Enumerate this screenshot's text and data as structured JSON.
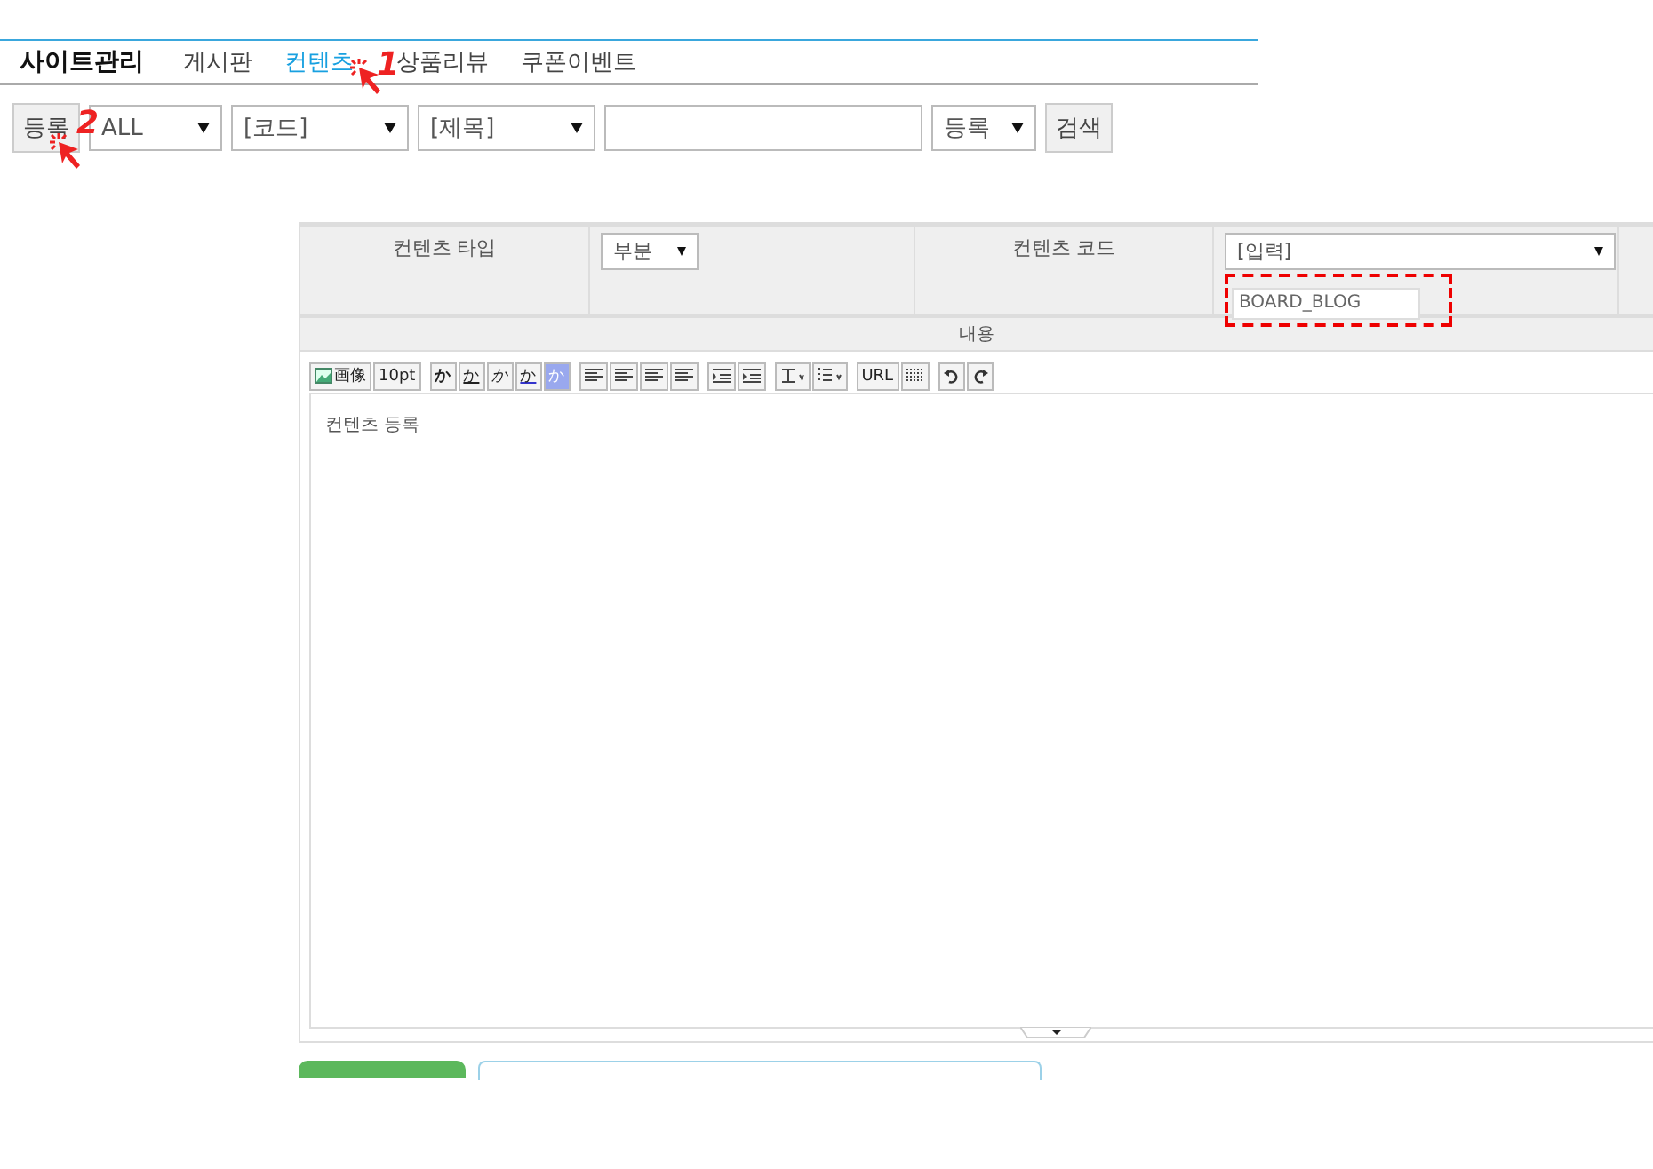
{
  "nav": {
    "title": "사이트관리",
    "tabs": [
      {
        "label": "게시판",
        "selected": false
      },
      {
        "label": "컨텐츠",
        "selected": true
      },
      {
        "label": "상품리뷰",
        "selected": false
      },
      {
        "label": "쿠폰이벤트",
        "selected": false
      }
    ]
  },
  "markers": [
    {
      "label": "1"
    },
    {
      "label": "2"
    }
  ],
  "toolbar": {
    "register_button": "등록",
    "type_select": "ALL",
    "code_select": "[코드]",
    "title_select": "[제목]",
    "order_select": "등록",
    "search_button": "검색"
  },
  "form": {
    "type_label": "컨텐츠 타입",
    "type_value": "부분",
    "code_label": "컨텐츠 코드",
    "code_select": "[입력]",
    "code_value": "BOARD_BLOG",
    "code_highlighted": true,
    "content_label": "내용"
  },
  "editor": {
    "tools": [
      {
        "kind": "image",
        "label": "画像"
      },
      {
        "kind": "text",
        "label": "10pt"
      },
      {
        "kind": "sep"
      },
      {
        "kind": "bold",
        "label": "か"
      },
      {
        "kind": "underline",
        "label": "か"
      },
      {
        "kind": "italic",
        "label": "か"
      },
      {
        "kind": "color",
        "label": "か"
      },
      {
        "kind": "bgcolor",
        "label": "か"
      },
      {
        "kind": "sep"
      },
      {
        "kind": "align"
      },
      {
        "kind": "align"
      },
      {
        "kind": "align"
      },
      {
        "kind": "align"
      },
      {
        "kind": "sep"
      },
      {
        "kind": "indent"
      },
      {
        "kind": "indent"
      },
      {
        "kind": "sep"
      },
      {
        "kind": "lineheight"
      },
      {
        "kind": "list"
      },
      {
        "kind": "sep"
      },
      {
        "kind": "text",
        "label": "URL"
      },
      {
        "kind": "hr"
      },
      {
        "kind": "sep"
      },
      {
        "kind": "undo"
      },
      {
        "kind": "redo"
      }
    ],
    "text": "컨텐츠 등록"
  }
}
